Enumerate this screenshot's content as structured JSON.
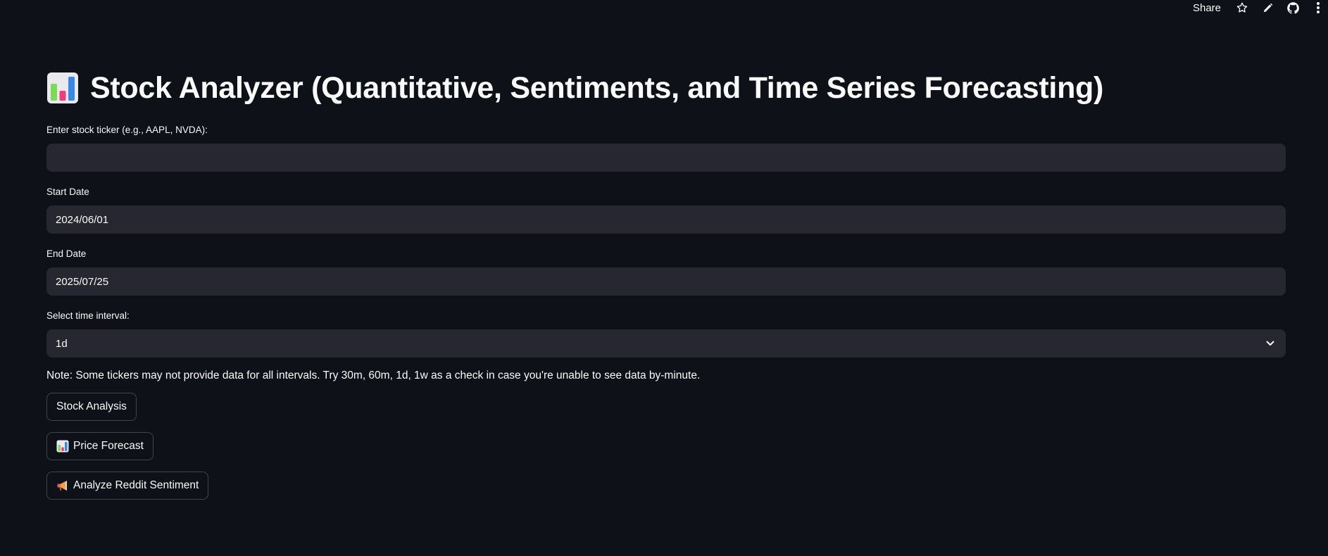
{
  "toolbar": {
    "share_label": "Share",
    "icons": [
      "star-icon",
      "pencil-icon",
      "github-icon",
      "kebab-menu-icon"
    ]
  },
  "header": {
    "title_icon": "bar-chart-emoji-icon",
    "title": "Stock Analyzer (Quantitative, Sentiments, and Time Series Forecasting)"
  },
  "form": {
    "ticker": {
      "label": "Enter stock ticker (e.g., AAPL, NVDA):",
      "value": "",
      "placeholder": ""
    },
    "start_date": {
      "label": "Start Date",
      "value": "2024/06/01"
    },
    "end_date": {
      "label": "End Date",
      "value": "2025/07/25"
    },
    "interval": {
      "label": "Select time interval:",
      "value": "1d",
      "icon": "chevron-down-icon"
    },
    "note": "Note: Some tickers may not provide data for all intervals. Try 30m, 60m, 1d, 1w as a check in case you're unable to see data by-minute."
  },
  "buttons": {
    "stock_analysis": "Stock Analysis",
    "price_forecast": "Price Forecast",
    "price_forecast_icon": "bar-chart-emoji-icon",
    "reddit_sentiment": "Analyze Reddit Sentiment",
    "reddit_sentiment_icon": "megaphone-emoji-icon"
  },
  "colors": {
    "background": "#0e1117",
    "input_background": "#262730",
    "text": "#fafafa"
  }
}
